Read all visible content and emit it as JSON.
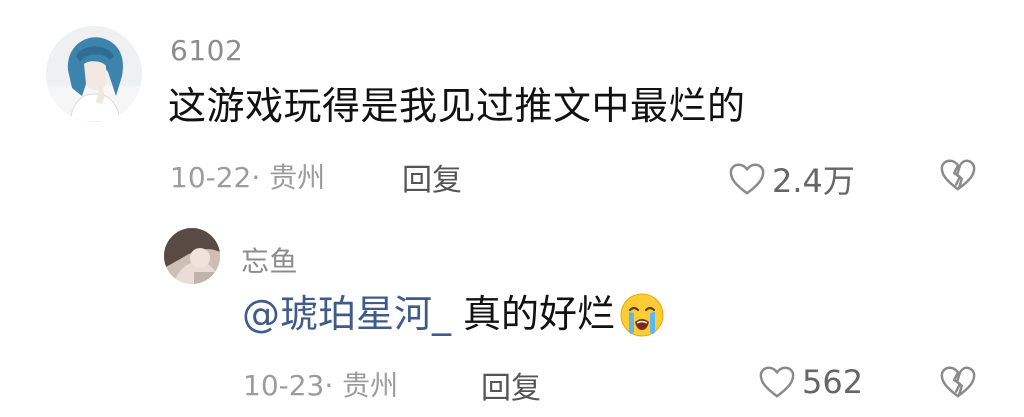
{
  "comment": {
    "username": "6102",
    "text": "这游戏玩得是我见过推文中最烂的",
    "date_location": "10-22· 贵州",
    "reply_label": "回复",
    "likes": "2.4万"
  },
  "reply": {
    "username": "忘鱼",
    "mention": "@琥珀星河_",
    "text": "真的好烂",
    "emoji": "crying-face-emoji",
    "date_location": "10-23· 贵州",
    "reply_label": "回复",
    "likes": "562"
  },
  "colors": {
    "username": "#8c8c8c",
    "text": "#111111",
    "mention": "#3f5b8a",
    "meta": "#9c9c9c",
    "icon": "#8a8a8a"
  },
  "icons": {
    "like": "heart-outline-icon",
    "dislike": "broken-heart-icon"
  }
}
